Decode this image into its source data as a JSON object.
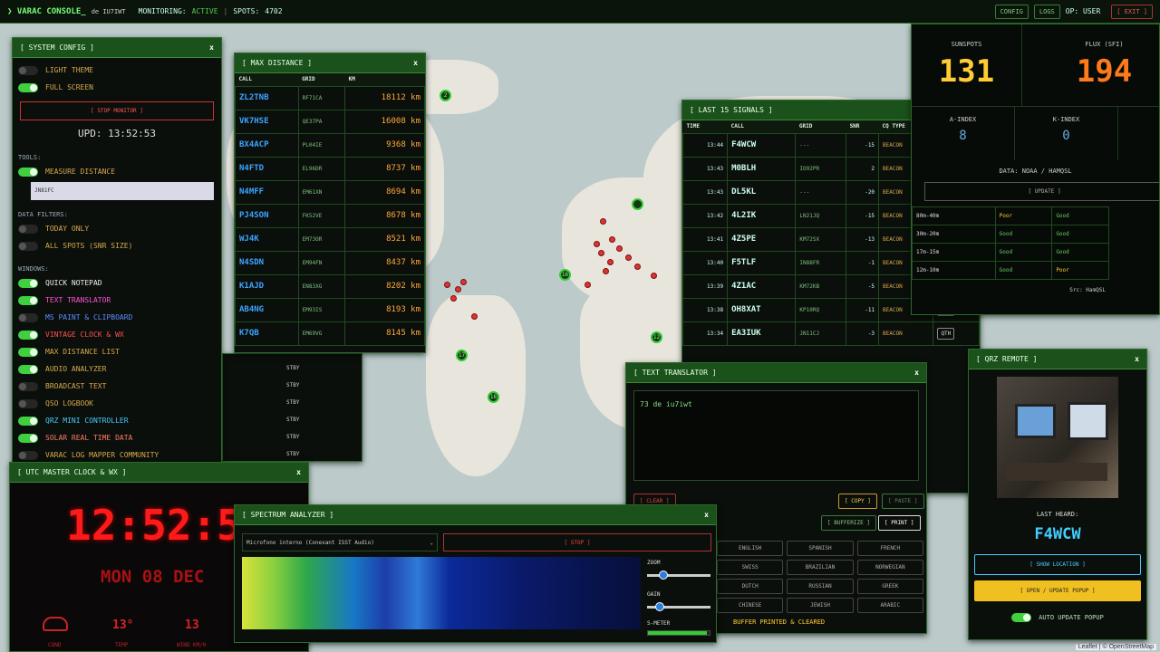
{
  "topbar": {
    "app": "❯ VARAC CONSOLE_",
    "de": "de IU7IWT",
    "monitoring_label": "MONITORING:",
    "monitoring_value": "ACTIVE",
    "spots_label": "SPOTS:",
    "spots_value": "4702",
    "config": "CONFIG",
    "logs": "LOGS",
    "op": "OP: USER",
    "exit": "[ EXIT ]"
  },
  "system": {
    "title": "[ SYSTEM CONFIG ]",
    "light": "LIGHT THEME",
    "full": "FULL SCREEN",
    "stop": "[ STOP MONITOR ]",
    "upd": "UPD: 13:52:53",
    "tools": "TOOLS:",
    "measure": "MEASURE DISTANCE",
    "grid_value": "JN81FC",
    "filters": "DATA FILTERS:",
    "today": "TODAY ONLY",
    "all": "ALL SPOTS (SNR SIZE)",
    "windows": "WINDOWS:",
    "w1": "QUICK NOTEPAD",
    "w2": "TEXT TRANSLATOR",
    "w3": "MS PAINT & CLIPBOARD",
    "w4": "VINTAGE CLOCK & WX",
    "w5": "MAX DISTANCE LIST",
    "w6": "AUDIO ANALYZER",
    "w7": "BROADCAST TEXT",
    "w8": "QSO LOGBOOK",
    "w9": "QRZ MINI CONTROLLER",
    "w10": "SOLAR REAL TIME DATA",
    "w11": "VARAC LOG MAPPER COMMUNITY"
  },
  "maxdist": {
    "title": "[ MAX DISTANCE ]",
    "h_call": "CALL",
    "h_grid": "GRID",
    "h_km": "KM",
    "rows": [
      {
        "call": "ZL2TNB",
        "grid": "RF71CA",
        "km": "18112 km"
      },
      {
        "call": "VK7HSE",
        "grid": "QE37PA",
        "km": "16008 km"
      },
      {
        "call": "BX4ACP",
        "grid": "PL04IE",
        "km": "9368 km"
      },
      {
        "call": "N4FTD",
        "grid": "EL96DR",
        "km": "8737 km"
      },
      {
        "call": "N4MFF",
        "grid": "EM61XN",
        "km": "8694 km"
      },
      {
        "call": "PJ4SON",
        "grid": "FK52VE",
        "km": "8678 km"
      },
      {
        "call": "WJ4K",
        "grid": "EM73OR",
        "km": "8521 km"
      },
      {
        "call": "N4SDN",
        "grid": "EM94FN",
        "km": "8437 km"
      },
      {
        "call": "K1AJD",
        "grid": "EN83XG",
        "km": "8202 km"
      },
      {
        "call": "AB4NG",
        "grid": "EM93IS",
        "km": "8193 km"
      },
      {
        "call": "K7QB",
        "grid": "EM69VG",
        "km": "8145 km"
      }
    ]
  },
  "stby": {
    "v1": "STBY",
    "v2": "STBY",
    "v3": "STBY",
    "v4": "STBY",
    "v5": "STBY",
    "v6": "STBY"
  },
  "signals": {
    "title": "[ LAST 15 SIGNALS ]",
    "h_time": "TIME",
    "h_call": "CALL",
    "h_grid": "GRID",
    "h_snr": "SNR",
    "h_cq": "CQ TYPE",
    "rows": [
      {
        "time": "13:44",
        "call": "F4WCW",
        "grid": "---",
        "snr": "-15",
        "type": "BEACON"
      },
      {
        "time": "13:43",
        "call": "M0BLH",
        "grid": "IO92PR",
        "snr": "2",
        "type": "BEACON"
      },
      {
        "time": "13:43",
        "call": "DL5KL",
        "grid": "---",
        "snr": "-20",
        "type": "BEACON"
      },
      {
        "time": "13:42",
        "call": "4L2IK",
        "grid": "LN21JQ",
        "snr": "-15",
        "type": "BEACON"
      },
      {
        "time": "13:41",
        "call": "4Z5PE",
        "grid": "KM72SX",
        "snr": "-13",
        "type": "BEACON"
      },
      {
        "time": "13:40",
        "call": "F5TLF",
        "grid": "IN88FR",
        "snr": "-1",
        "type": "BEACON"
      },
      {
        "time": "13:39",
        "call": "4Z1AC",
        "grid": "KM72KB",
        "snr": "-5",
        "type": "BEACON"
      },
      {
        "time": "13:38",
        "call": "OH8XAT",
        "grid": "KP10RQ",
        "snr": "-11",
        "type": "BEACON"
      },
      {
        "time": "13:34",
        "call": "EA3IUK",
        "grid": "JN11CJ",
        "snr": "-3",
        "type": "BEACON"
      }
    ],
    "qth": "QTH"
  },
  "solar": {
    "sunspots_label": "SUNSPOTS",
    "sunspots": "131",
    "flux_label": "FLUX (SFI)",
    "flux": "194",
    "a_label": "A-INDEX",
    "a": "8",
    "k_label": "K-INDEX",
    "k": "0",
    "data": "DATA: NOAA / HAMQSL",
    "update": "[ UPDATE ]",
    "bands": [
      {
        "band": "80m-40m",
        "day": "Poor",
        "night": "Good"
      },
      {
        "band": "30m-20m",
        "day": "Good",
        "night": "Good"
      },
      {
        "band": "17m-15m",
        "day": "Good",
        "night": "Good"
      },
      {
        "band": "12m-10m",
        "day": "Good",
        "night": "Poor"
      }
    ],
    "src": "Src: HamQSL"
  },
  "translator": {
    "title": "[ TEXT TRANSLATOR ]",
    "text": "73 de iu7iwt",
    "clear": "[ CLEAR ]",
    "copy": "[ COPY ]",
    "paste": "[ PASTE ]",
    "bufferize": "[ BUFFERIZE ]",
    "print": "[ PRINT ]",
    "langs": [
      "ENGLISH",
      "SPANISH",
      "FRENCH",
      "SWISS",
      "BRAZILIAN",
      "NORWEGIAN",
      "DUTCH",
      "RUSSIAN",
      "GREEK",
      "CHINESE",
      "JEWISH",
      "ARABIC"
    ],
    "status": "BUFFER PRINTED & CLEARED"
  },
  "qrz": {
    "title": "[ QRZ REMOTE ]",
    "last_label": "LAST HEARD:",
    "last": "F4WCW",
    "show": "[ SHOW LOCATION ]",
    "open": "[ OPEN / UPDATE POPUP ]",
    "auto": "AUTO UPDATE POPUP"
  },
  "clock": {
    "title": "[ UTC MASTER CLOCK & WX ]",
    "time": "12:52:56",
    "date": "MON 08 DEC",
    "cond": "COND",
    "temp_val": "13°",
    "temp": "TEMP",
    "wind_val": "13",
    "wind": "WIND KM/H",
    "uv": "UV"
  },
  "spectrum": {
    "title": "[ SPECTRUM ANALYZER ]",
    "device": "Microfono interno (Conexant ISST Audio)",
    "stop": "[ STOP ]",
    "zoom": "ZOOM",
    "gain": "GAIN",
    "smeter": "S-METER",
    "zoom_level": 0.22,
    "gain_level": 0.15,
    "smeter_level": 0.95
  },
  "map": {
    "attrib": "Leaflet | © OpenStreetMap"
  }
}
